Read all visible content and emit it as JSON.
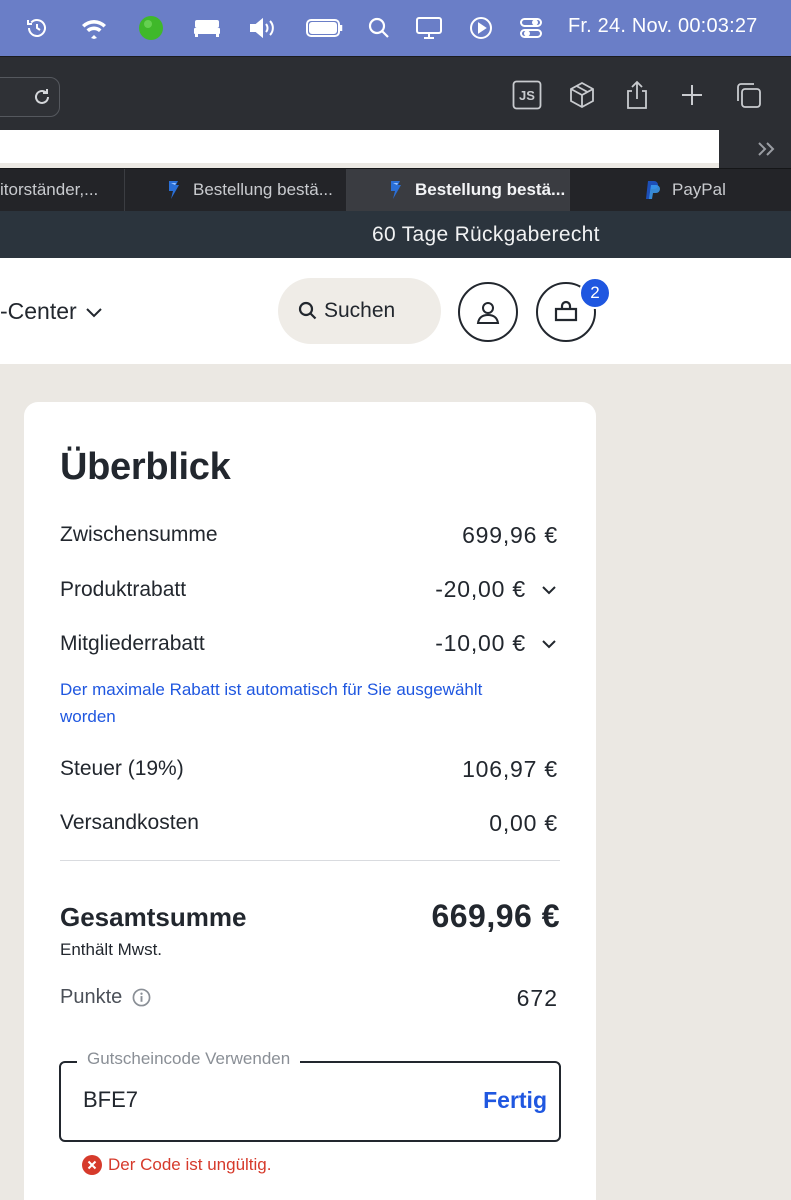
{
  "menubar": {
    "clock": "Fr. 24. Nov.  00:03:27",
    "icons": [
      "time-machine-icon",
      "wifi-icon",
      "status-dot-icon",
      "bed-icon",
      "volume-icon",
      "battery-icon",
      "spotlight-icon",
      "display-icon",
      "play-icon",
      "control-center-icon"
    ]
  },
  "toolbar": {
    "icons": [
      "reload-icon",
      "js-icon",
      "cube-icon",
      "share-icon",
      "new-tab-icon",
      "tab-overview-icon"
    ],
    "js_label": "JS"
  },
  "tabs": [
    {
      "label": "itorständer,...",
      "active": false
    },
    {
      "label": "Bestellung bestä...",
      "active": false
    },
    {
      "label": "Bestellung bestä...",
      "active": true
    },
    {
      "label": "PayPal",
      "active": false
    }
  ],
  "promo": {
    "text": "60 Tage Rückgaberecht"
  },
  "header": {
    "nav_partial": "-Center",
    "search_label": "Suchen",
    "cart_count": "2"
  },
  "summary": {
    "title": "Überblick",
    "rows": [
      {
        "label": "Zwischensumme",
        "value": "699,96 €"
      },
      {
        "label": "Produktrabatt",
        "value": "-20,00 €"
      },
      {
        "label": "Mitgliederrabatt",
        "value": "-10,00 €"
      },
      {
        "label": "Steuer (19%)",
        "value": "106,97 €"
      },
      {
        "label": "Versandkosten",
        "value": "0,00 €"
      }
    ],
    "discount_note": "Der maximale Rabatt ist automatisch für Sie ausgewählt worden",
    "total_label": "Gesamtsumme",
    "total_value": "669,96 €",
    "vat_note": "Enthält Mwst.",
    "points_label": "Punkte",
    "points_value": "672",
    "voucher_legend": "Gutscheincode Verwenden",
    "voucher_value": "BFE7",
    "voucher_done": "Fertig",
    "error_text": "Der Code ist ungültig."
  },
  "colors": {
    "menubar": "#6a7ec7",
    "accent": "#1f57e0",
    "error": "#d63a2b",
    "page_bg": "#ebe8e3",
    "promo_bg": "#2b343d"
  }
}
